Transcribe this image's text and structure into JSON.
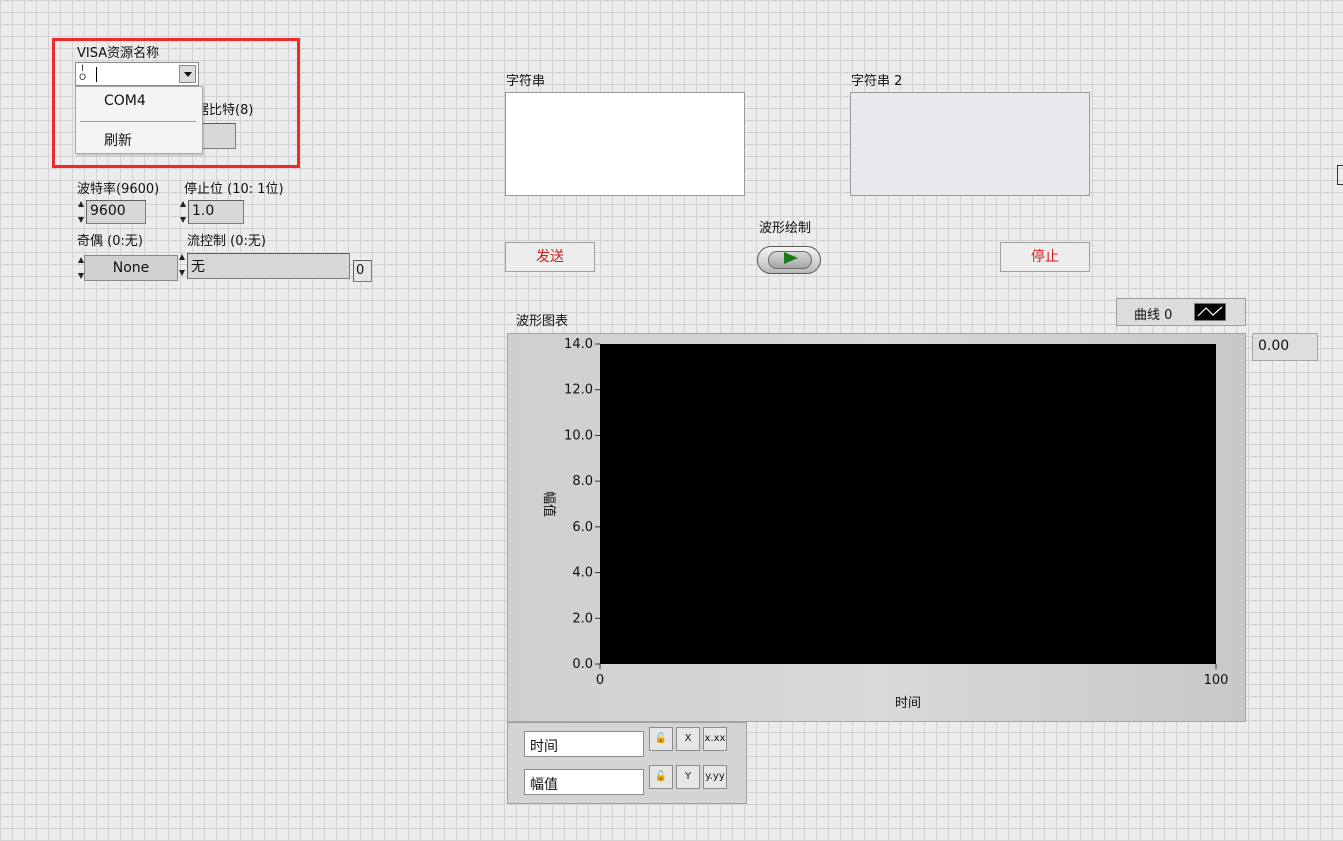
{
  "visa": {
    "label": "VISA资源名称",
    "io_glyph_top": "I",
    "io_glyph_bottom": "O",
    "menu_items": [
      "COM4",
      "刷新"
    ]
  },
  "data_bits": {
    "label_partial": "据比特(8)"
  },
  "baud": {
    "label": "波特率(9600)",
    "value": "9600"
  },
  "stop_bits": {
    "label": "停止位 (10: 1位)",
    "value": "1.0"
  },
  "parity": {
    "label": "奇偶 (0:无)",
    "value": "None"
  },
  "flow": {
    "label": "流控制 (0:无)",
    "value": "无",
    "index": "0"
  },
  "string1": {
    "label": "字符串",
    "value": ""
  },
  "string2": {
    "label": "字符串 2",
    "value": ""
  },
  "buttons": {
    "send": "发送",
    "stop": "停止"
  },
  "toggle": {
    "label": "波形绘制"
  },
  "colors": {
    "red_highlight": "#ef2a2a",
    "button_text": "#cc2020",
    "plot_bg": "#000000",
    "led": "#1c7a1c"
  },
  "chart": {
    "label": "波形图表",
    "legend": "曲线 0",
    "digital_display": "0.00"
  },
  "scale_legend": {
    "x_name": "时间",
    "y_name": "幅值"
  },
  "chart_data": {
    "type": "line",
    "title": "",
    "xlabel": "时间",
    "ylabel": "幅值",
    "xlim": [
      0,
      100
    ],
    "ylim": [
      0,
      14
    ],
    "x_ticks": [
      "0",
      "100"
    ],
    "y_ticks": [
      "0.0",
      "2.0",
      "4.0",
      "6.0",
      "8.0",
      "10.0",
      "12.0",
      "14.0"
    ],
    "series": [
      {
        "name": "曲线 0",
        "values": []
      }
    ],
    "grid": false,
    "legend": "top-right"
  }
}
